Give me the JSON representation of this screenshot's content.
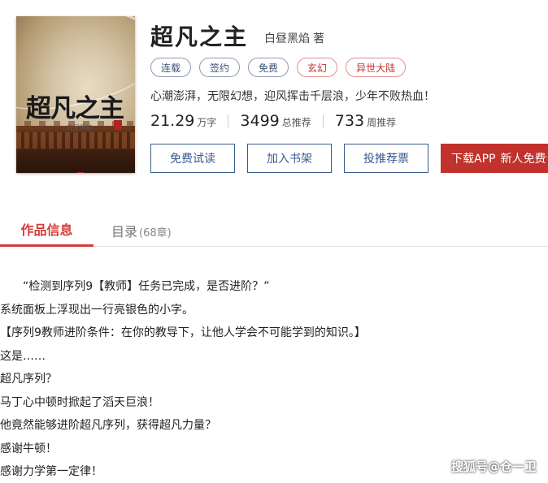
{
  "book": {
    "title": "超凡之主",
    "author": "白昼黑焰",
    "author_role": "著",
    "cover": {
      "title_text": "超凡之主",
      "author_text": "白昼黑焰"
    },
    "tags": [
      {
        "label": "连载",
        "style": "blue"
      },
      {
        "label": "签约",
        "style": "blue"
      },
      {
        "label": "免费",
        "style": "blue"
      },
      {
        "label": "玄幻",
        "style": "red"
      },
      {
        "label": "异世大陆",
        "style": "red"
      }
    ],
    "description": "心潮澎湃，无限幻想，迎风挥击千层浪，少年不败热血！",
    "stats": [
      {
        "value": "21.29",
        "unit": "万字"
      },
      {
        "value": "3499",
        "unit": "总推荐"
      },
      {
        "value": "733",
        "unit": "周推荐"
      }
    ]
  },
  "actions": {
    "free_read": "免费试读",
    "add_shelf": "加入书架",
    "vote": "投推荐票",
    "download": "下载APP",
    "download_sub": "新人免费读"
  },
  "tabs": {
    "info": "作品信息",
    "toc": "目录",
    "toc_count": "(68章)"
  },
  "content": {
    "paragraphs": [
      "“检测到序列9【教师】任务已完成，是否进阶？”",
      "系统面板上浮现出一行亮银色的小字。",
      "【序列9教师进阶条件：在你的教导下，让他人学会不可能学到的知识。】",
      "这是……",
      "超凡序列？",
      "马丁心中顿时掀起了滔天巨浪！",
      "他竟然能够进阶超凡序列，获得超凡力量？",
      "感谢牛顿！",
      "感谢力学第一定律！"
    ]
  },
  "watermark": "搜狐号@仓一卫",
  "colors": {
    "accent_red": "#c0322b",
    "tab_red": "#d83a3a",
    "button_blue": "#3b5b8c"
  }
}
